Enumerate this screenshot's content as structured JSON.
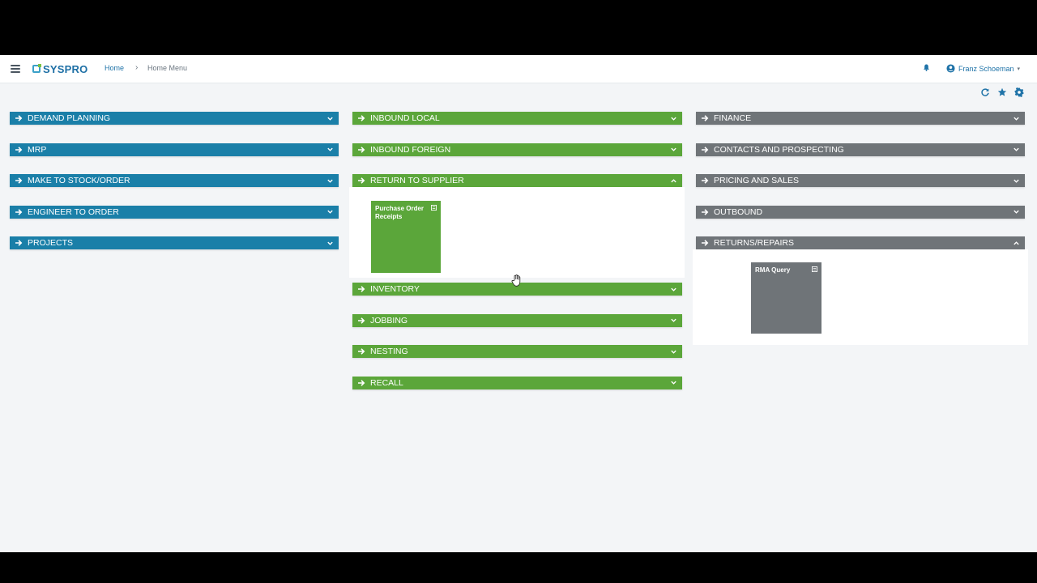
{
  "app": {
    "brand": "SYSPRO",
    "breadcrumb": {
      "home": "Home",
      "separator": "›",
      "current": "Home Menu"
    },
    "user": {
      "name": "Franz Schoeman",
      "caret": "▾"
    }
  },
  "colors": {
    "blue": "#1a7fa8",
    "green": "#5ba63a",
    "grey": "#6f7478"
  },
  "columns": {
    "left": [
      "DEMAND PLANNING",
      "MRP",
      "MAKE TO STOCK/ORDER",
      "ENGINEER TO ORDER",
      "PROJECTS"
    ],
    "middle": {
      "inbound_local": "INBOUND LOCAL",
      "inbound_foreign": "INBOUND FOREIGN",
      "return_to_supplier": "RETURN TO SUPPLIER",
      "return_tile": "Purchase Order Receipts",
      "inventory": "INVENTORY",
      "jobbing": "JOBBING",
      "nesting": "NESTING",
      "recall": "RECALL"
    },
    "right": {
      "finance": "FINANCE",
      "contacts": "CONTACTS AND PROSPECTING",
      "pricing": "PRICING AND SALES",
      "outbound": "OUTBOUND",
      "returns": "RETURNS/REPAIRS",
      "returns_tile": "RMA Query"
    }
  },
  "icons": {
    "menu": "hamburger-icon",
    "bell": "bell-icon",
    "user": "user-circle-icon",
    "refresh": "refresh-icon",
    "favorite": "star-icon",
    "settings": "gear-icon"
  }
}
